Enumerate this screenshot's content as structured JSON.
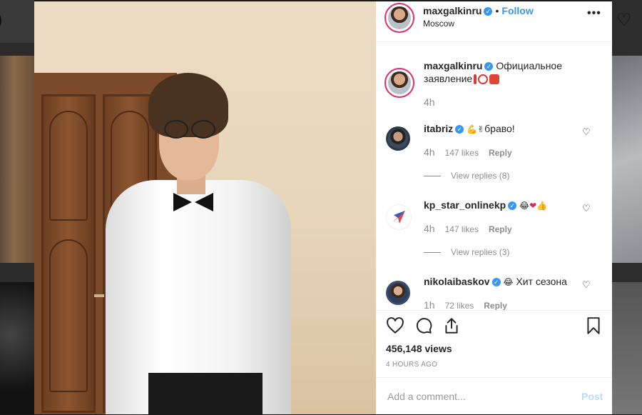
{
  "post": {
    "username": "maxgalkinru",
    "follow_label": "Follow",
    "dot": "•",
    "location": "Moscow",
    "more_label": "•••"
  },
  "caption": {
    "username": "maxgalkinru",
    "text": "Официальное заявление",
    "time": "4h"
  },
  "comments": [
    {
      "username": "itabriz",
      "text": "браво!",
      "emojis": [
        "💪",
        "✌"
      ],
      "time": "4h",
      "likes": "147 likes",
      "reply": "Reply",
      "view_replies": "View replies (8)"
    },
    {
      "username": "kp_star_onlinekp",
      "text": "",
      "emojis": [
        "😂",
        "❤",
        "👍"
      ],
      "time": "4h",
      "likes": "147 likes",
      "reply": "Reply",
      "view_replies": "View replies (3)"
    },
    {
      "username": "nikolaibaskov",
      "text": "Хит сезона",
      "emojis": [
        "😂"
      ],
      "time": "1h",
      "likes": "72 likes",
      "reply": "Reply"
    }
  ],
  "stats": {
    "views": "456,148 views",
    "posted": "4 HOURS AGO"
  },
  "composer": {
    "placeholder": "Add a comment...",
    "post_label": "Post"
  },
  "icons": {
    "like": "heart-icon",
    "comment": "comment-icon",
    "share": "share-icon",
    "save": "bookmark-icon",
    "more": "more-options-icon"
  },
  "colors": {
    "link": "#3897f0",
    "verified": "#3897f0",
    "muted": "#8e8e8e",
    "post_disabled": "#b9dcfb"
  }
}
